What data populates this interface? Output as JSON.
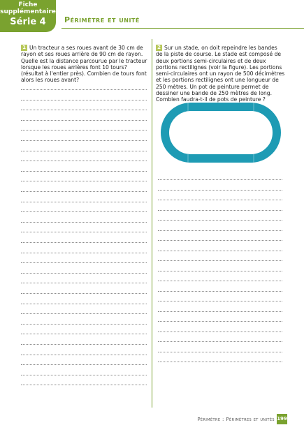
{
  "header": {
    "tab_line1": "Fiche",
    "tab_line2": "supplémentaire",
    "tab_line3": "Série 4",
    "title": "Périmètre et unité"
  },
  "exercises": [
    {
      "number": "1",
      "text": "Un tracteur a ses roues avant de 30 cm de rayon et ses roues arrière de 90 cm de rayon. Quelle est la distance parcourue par le tracteur lorsque les roues arrières font 10 tours? (résultat à l'entier près). Combien de tours font alors les roues avant?"
    },
    {
      "number": "2",
      "text": "Sur un stade, on doit repeindre les bandes de la piste de course. Le stade est composé de deux portions semi-circulaires et de deux portions rectilignes (voir la figure). Les portions semi-circulaires ont un rayon de 500 décimètres et les portions rectilignes ont une longueur de 250 mètres. Un pot de peinture permet de dessiner une bande de 250 mètres de long. Combien faudra-t-il de pots de peinture ?"
    }
  ],
  "colors": {
    "accent": "#7aa22f",
    "track": "#1e9bb4",
    "number_badge": "#b7c85a"
  },
  "footer": {
    "text": "Périmètre : Périmètres et unités",
    "page_number": "199"
  }
}
